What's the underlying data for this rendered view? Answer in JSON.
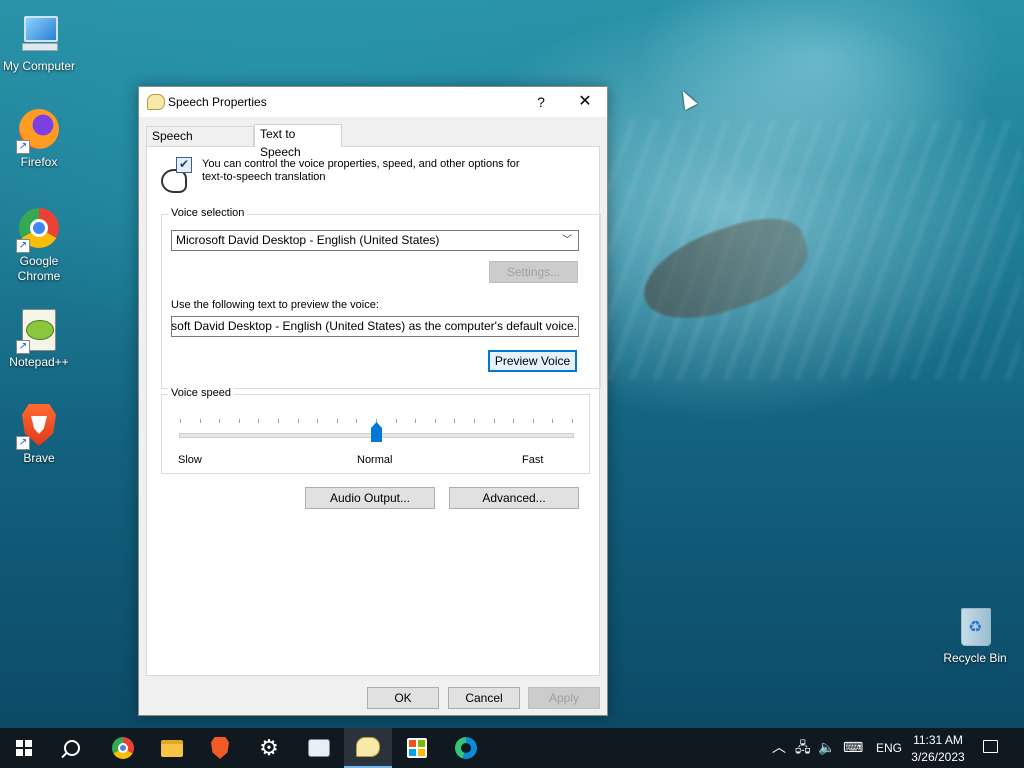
{
  "desktop": {
    "icons": [
      {
        "label": "My Computer",
        "icon": "computer-icon"
      },
      {
        "label": "Firefox",
        "icon": "firefox-icon"
      },
      {
        "label": "Google Chrome",
        "icon": "chrome-icon"
      },
      {
        "label": "Notepad++",
        "icon": "notepadpp-icon"
      },
      {
        "label": "Brave",
        "icon": "brave-icon"
      },
      {
        "label": "Recycle Bin",
        "icon": "recycle-bin-icon"
      }
    ]
  },
  "dialog": {
    "title": "Speech Properties",
    "help_glyph": "?",
    "close_glyph": "✕",
    "tabs": [
      {
        "label": "Speech Recognition",
        "active": false
      },
      {
        "label": "Text to Speech",
        "active": true
      }
    ],
    "intro": "You can control the voice properties, speed, and other options for text-to-speech translation",
    "voice_selection": {
      "label": "Voice selection",
      "selected_voice": "Microsoft David Desktop - English (United States)",
      "settings_label": "Settings...",
      "preview_label": "Use the following text to preview the voice:",
      "preview_text": "You have selected Microsoft David Desktop - English (United States) as the computer's default voice.",
      "preview_button": "Preview Voice"
    },
    "voice_speed": {
      "label": "Voice speed",
      "slow": "Slow",
      "normal": "Normal",
      "fast": "Fast",
      "value_fraction": 0.5,
      "tick_count": 21
    },
    "audio_output_label": "Audio Output...",
    "advanced_label": "Advanced...",
    "ok_label": "OK",
    "cancel_label": "Cancel",
    "apply_label": "Apply"
  },
  "taskbar": {
    "language": "ENG",
    "time": "11:31 AM",
    "date": "3/26/2023",
    "colors": {
      "background": "#101820",
      "accent": "#76b9ed"
    }
  }
}
